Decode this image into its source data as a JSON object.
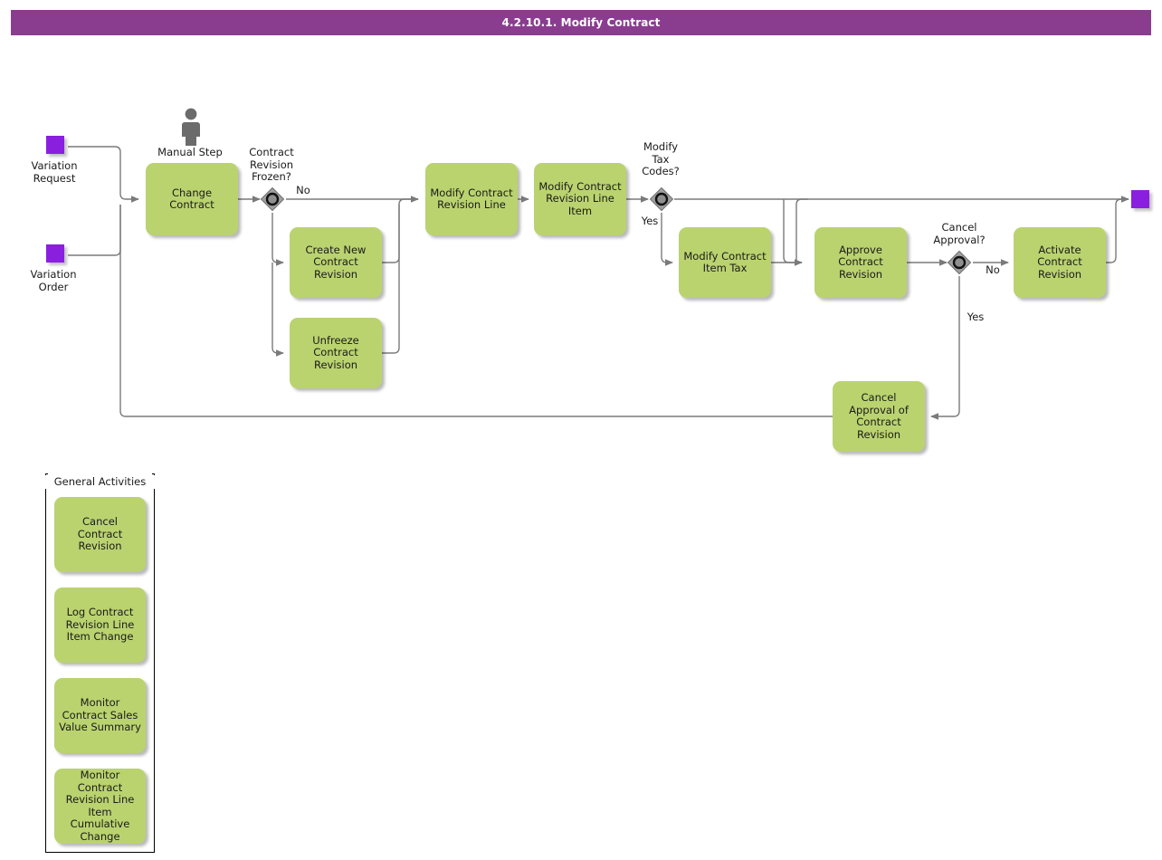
{
  "header": {
    "title": "4.2.10.1. Modify Contract",
    "bar_color": "#8A3D8F"
  },
  "palette": {
    "task_fill": "#BAD36F",
    "event_fill": "#8A1FE0",
    "gateway_fill": "#9E9E9E",
    "connector": "#7a7a7a"
  },
  "start_events": [
    {
      "id": "variation-request",
      "label": "Variation\nRequest"
    },
    {
      "id": "variation-order",
      "label": "Variation\nOrder"
    }
  ],
  "end_events": [
    {
      "id": "end-event",
      "label": ""
    }
  ],
  "annotations": {
    "manual_step": "Manual Step"
  },
  "gateways": [
    {
      "id": "contract-revision-frozen",
      "label": "Contract\nRevision\nFrozen?",
      "branches": [
        "No"
      ]
    },
    {
      "id": "modify-tax-codes",
      "label": "Modify\nTax\nCodes?",
      "branches": [
        "Yes"
      ]
    },
    {
      "id": "cancel-approval",
      "label": "Cancel\nApproval?",
      "branches": [
        "No",
        "Yes"
      ]
    }
  ],
  "flow_labels": {
    "frozen_no": "No",
    "tax_yes": "Yes",
    "cancel_no": "No",
    "cancel_yes": "Yes"
  },
  "tasks": [
    {
      "id": "change-contract",
      "label": "Change\nContract"
    },
    {
      "id": "create-new-contract-revision",
      "label": "Create New\nContract\nRevision"
    },
    {
      "id": "unfreeze-contract-revision",
      "label": "Unfreeze\nContract\nRevision"
    },
    {
      "id": "modify-contract-revision-line",
      "label": "Modify Contract\nRevision Line"
    },
    {
      "id": "modify-contract-revision-line-item",
      "label": "Modify Contract\nRevision Line\nItem"
    },
    {
      "id": "modify-contract-item-tax",
      "label": "Modify Contract\nItem Tax"
    },
    {
      "id": "approve-contract-revision",
      "label": "Approve\nContract\nRevision"
    },
    {
      "id": "activate-contract-revision",
      "label": "Activate\nContract\nRevision"
    },
    {
      "id": "cancel-approval-of-contract-revision",
      "label": "Cancel Approval\nof Contract\nRevision"
    }
  ],
  "general_activities": {
    "title": "General Activities",
    "items": [
      {
        "id": "cancel-contract-revision",
        "label": "Cancel Contract\nRevision"
      },
      {
        "id": "log-contract-revision-line-item-change",
        "label": "Log Contract\nRevision Line\nItem Change"
      },
      {
        "id": "monitor-contract-sales-value-summary",
        "label": "Monitor Contract\nSales Value\nSummary"
      },
      {
        "id": "monitor-contract-revision-line-item-cumulative-change",
        "label": "Monitor Contract\nRevision Line\nItem Cumulative\nChange"
      }
    ]
  }
}
